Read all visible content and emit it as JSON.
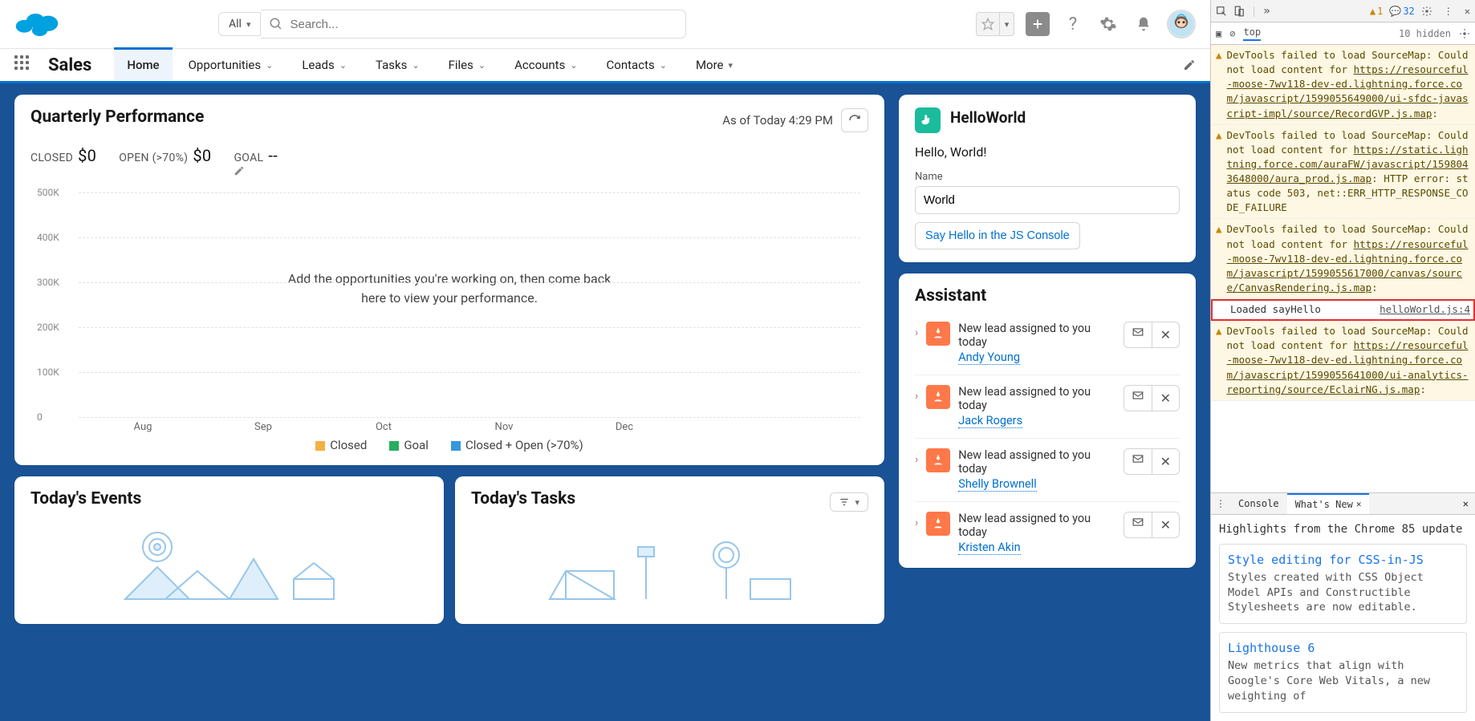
{
  "header": {
    "search_scope": "All",
    "search_placeholder": "Search..."
  },
  "nav": {
    "app_name": "Sales",
    "items": [
      "Home",
      "Opportunities",
      "Leads",
      "Tasks",
      "Files",
      "Accounts",
      "Contacts",
      "More"
    ],
    "active": "Home"
  },
  "qp": {
    "title": "Quarterly Performance",
    "asof": "As of Today 4:29 PM",
    "closed_label": "CLOSED",
    "closed_val": "$0",
    "open_label": "OPEN (>70%)",
    "open_val": "$0",
    "goal_label": "GOAL",
    "goal_val": "--",
    "empty_msg": "Add the opportunities you're working on, then come back here to view your performance.",
    "legend": {
      "closed": "Closed",
      "goal": "Goal",
      "combo": "Closed + Open (>70%)"
    }
  },
  "chart_data": {
    "type": "bar",
    "categories": [
      "Aug",
      "Sep",
      "Oct",
      "Nov",
      "Dec"
    ],
    "series": [
      {
        "name": "Closed",
        "values": [
          0,
          0,
          0,
          0,
          0
        ],
        "color": "#f5b041"
      },
      {
        "name": "Goal",
        "values": [
          0,
          0,
          0,
          0,
          0
        ],
        "color": "#27ae60"
      },
      {
        "name": "Closed + Open (>70%)",
        "values": [
          0,
          0,
          0,
          0,
          0
        ],
        "color": "#3498db"
      }
    ],
    "ylim": [
      0,
      500000
    ],
    "yticks": [
      0,
      100000,
      200000,
      300000,
      400000,
      500000
    ],
    "ytick_labels": [
      "0",
      "100K",
      "200K",
      "300K",
      "400K",
      "500K"
    ],
    "xlabel": "",
    "ylabel": "",
    "title": "Quarterly Performance"
  },
  "events": {
    "title": "Today's Events"
  },
  "tasks": {
    "title": "Today's Tasks"
  },
  "hello": {
    "title": "HelloWorld",
    "greeting": "Hello, World!",
    "field_label": "Name",
    "field_value": "World",
    "button": "Say Hello in the JS Console"
  },
  "assistant": {
    "title": "Assistant",
    "items": [
      {
        "text": "New lead assigned to you today",
        "link": "Andy Young"
      },
      {
        "text": "New lead assigned to you today",
        "link": "Jack Rogers"
      },
      {
        "text": "New lead assigned to you today",
        "link": "Shelly Brownell"
      },
      {
        "text": "New lead assigned to you today",
        "link": "Kristen Akin"
      }
    ]
  },
  "devtools": {
    "warn_count": "1",
    "msg_count": "32",
    "context": "top",
    "hidden": "10 hidden",
    "log_text": "Loaded sayHello",
    "log_src": "helloWorld.js:4",
    "warnings": [
      {
        "pre": "DevTools failed to load SourceMap: Could not load content for ",
        "link": "https://resourceful-moose-7wv118-dev-ed.lightning.force.com/javascript/1599055649000/ui-sfdc-javascript-impl/source/RecordGVP.js.map",
        "post": ":"
      },
      {
        "pre": "DevTools failed to load SourceMap: Could not load content for ",
        "link": "https://static.lightning.force.com/auraFW/javascript/1598043648000/aura_prod.js.map",
        "post": ": HTTP error: status code 503, net::ERR_HTTP_RESPONSE_CODE_FAILURE"
      },
      {
        "pre": "DevTools failed to load SourceMap: Could not load content for ",
        "link": "https://resourceful-moose-7wv118-dev-ed.lightning.force.com/javascript/1599055617000/canvas/source/CanvasRendering.js.map",
        "post": ":"
      },
      {
        "pre": "DevTools failed to load SourceMap: Could not load content for ",
        "link": "https://resourceful-moose-7wv118-dev-ed.lightning.force.com/javascript/1599055641000/ui-analytics-reporting/source/EclairNG.js.map",
        "post": ":"
      }
    ],
    "tabs": {
      "console": "Console",
      "whatsnew": "What's New"
    },
    "whatsnew": {
      "headline": "Highlights from the Chrome 85 update",
      "cards": [
        {
          "title": "Style editing for CSS-in-JS",
          "body": "Styles created with CSS Object Model APIs and Constructible Stylesheets are now editable."
        },
        {
          "title": "Lighthouse 6",
          "body": "New metrics that align with Google's Core Web Vitals, a new weighting of"
        }
      ]
    }
  }
}
